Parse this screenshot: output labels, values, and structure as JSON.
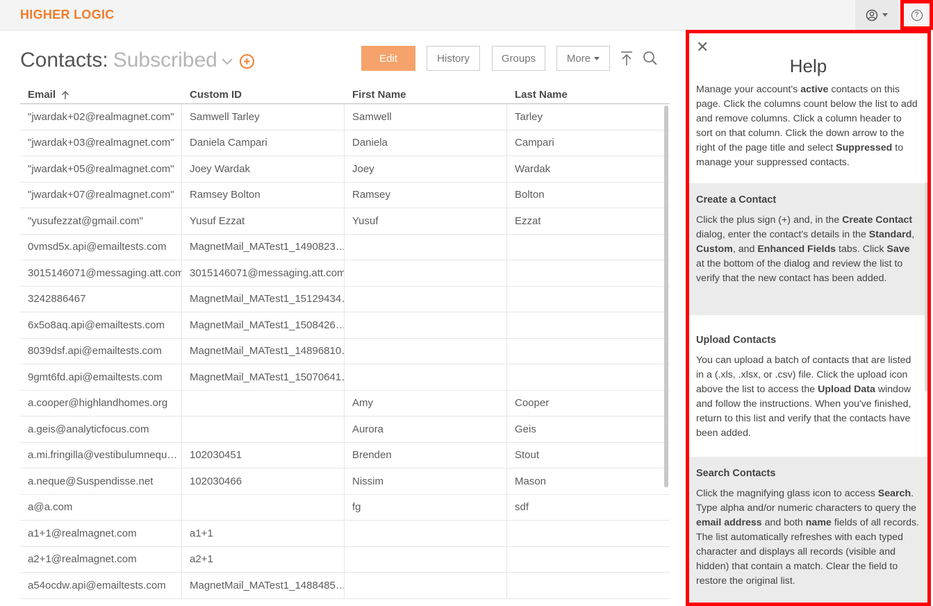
{
  "app": {
    "logo": "HIGHER LOGIC"
  },
  "header": {
    "user_icon": "user-circle-icon",
    "help_icon": "question-circle-icon",
    "help_glyph": "?"
  },
  "page": {
    "title_main": "Contacts:",
    "title_view": "Subscribed"
  },
  "toolbar": {
    "edit": "Edit",
    "history": "History",
    "groups": "Groups",
    "more": "More"
  },
  "table": {
    "headers": [
      "Email",
      "Custom ID",
      "First Name",
      "Last Name"
    ],
    "rows": [
      [
        "\"jwardak+02@realmagnet.com\"",
        "Samwell Tarley",
        "Samwell",
        "Tarley"
      ],
      [
        "\"jwardak+03@realmagnet.com\"",
        "Daniela Campari",
        "Daniela",
        "Campari"
      ],
      [
        "\"jwardak+05@realmagnet.com\"",
        "Joey Wardak",
        "Joey",
        "Wardak"
      ],
      [
        "\"jwardak+07@realmagnet.com\"",
        "Ramsey Bolton",
        "Ramsey",
        "Bolton"
      ],
      [
        "\"yusufezzat@gmail.com\"",
        "Yusuf Ezzat",
        "Yusuf",
        "Ezzat"
      ],
      [
        "0vmsd5x.api@emailtests.com",
        "MagnetMail_MATest1_1490823…",
        "",
        ""
      ],
      [
        "3015146071@messaging.att.com",
        "3015146071@messaging.att.com",
        "",
        ""
      ],
      [
        "3242886467",
        "MagnetMail_MATest1_15129434…",
        "",
        ""
      ],
      [
        "6x5o8aq.api@emailtests.com",
        "MagnetMail_MATest1_1508426…",
        "",
        ""
      ],
      [
        "8039dsf.api@emailtests.com",
        "MagnetMail_MATest1_14896810…",
        "",
        ""
      ],
      [
        "9gmt6fd.api@emailtests.com",
        "MagnetMail_MATest1_15070641…",
        "",
        ""
      ],
      [
        "a.cooper@highlandhomes.org",
        "",
        "Amy",
        "Cooper"
      ],
      [
        "a.geis@analyticfocus.com",
        "",
        "Aurora",
        "Geis"
      ],
      [
        "a.mi.fringilla@vestibulumnequ…",
        "102030451",
        "Brenden",
        "Stout"
      ],
      [
        "a.neque@Suspendisse.net",
        "102030466",
        "Nissim",
        "Mason"
      ],
      [
        "a@a.com",
        "",
        "fg",
        "sdf"
      ],
      [
        "a1+1@realmagnet.com",
        "a1+1",
        "",
        ""
      ],
      [
        "a2+1@realmagnet.com",
        "a2+1",
        "",
        ""
      ],
      [
        "a54ocdw.api@emailtests.com",
        "MagnetMail_MATest1_1488485…",
        "",
        ""
      ]
    ]
  },
  "help": {
    "title": "Help",
    "sections": [
      {
        "heading": "",
        "html": "Manage your account's <b>active</b> contacts on this page. Click the columns count below the list to add and remove columns. Click a column header to sort on that column. Click the down arrow to the right of the page title and select <b>Suppressed</b> to manage your suppressed contacts."
      },
      {
        "heading": "Create a Contact",
        "html": "Click the plus sign (+) and, in the <b>Create Contact</b> dialog, enter the contact's details in the <b>Standard</b>, <b>Custom</b>, and <b>Enhanced Fields</b> tabs. Click <b>Save</b> at the bottom of the dialog and review the list to verify that the new contact has been added."
      },
      {
        "heading": "Upload Contacts",
        "html": "You can upload a batch of contacts that are listed in a (.xls, .xlsx, or .csv) file. Click the upload icon above the list to access the <b>Upload Data</b> window and follow the instructions. When you've finished, return to this list and verify that the contacts have been added."
      },
      {
        "heading": "Search Contacts",
        "html": "Click the magnifying glass icon to access <b>Search</b>. Type alpha and/or numeric characters to query the <b>email address</b> and both <b>name</b> fields of all records. The list automatically refreshes with each typed character and displays all records (visible and hidden) that contain a match. Clear the field to restore the original list."
      }
    ]
  },
  "colors": {
    "accent": "#f07d2c",
    "edit_button": "#f5a36a",
    "highlight_border": "#ff0000"
  }
}
